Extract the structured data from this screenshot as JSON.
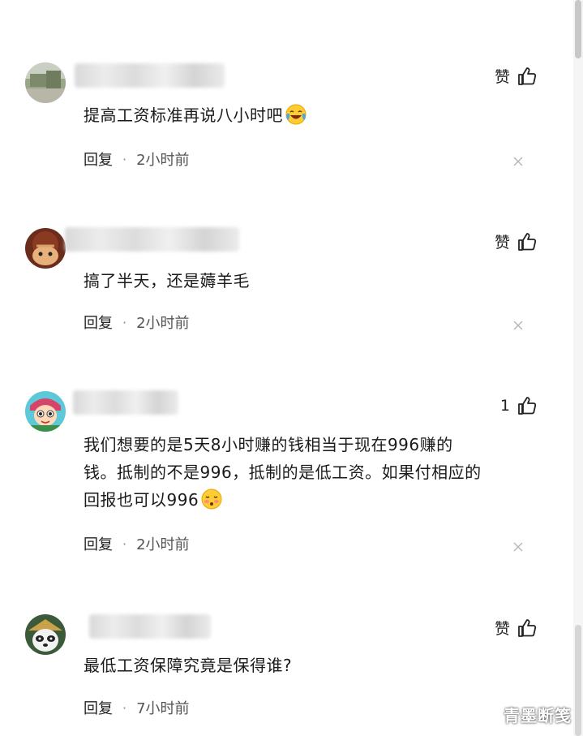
{
  "comments": [
    {
      "avatar_icon": "landscape-avatar-icon",
      "like_label": "赞",
      "text": "提高工资标准再说八小时吧",
      "emoji": "crying-laughing-emoji",
      "reply_label": "回复",
      "separator": "·",
      "time": "2小时前"
    },
    {
      "avatar_icon": "character-avatar-icon",
      "like_label": "赞",
      "text": "搞了半天，还是薅羊毛",
      "reply_label": "回复",
      "separator": "·",
      "time": "2小时前"
    },
    {
      "avatar_icon": "cartoon-girl-avatar-icon",
      "like_label": "1",
      "text_line1": "我们想要的是5天8小时赚的钱相当于现在996赚的",
      "text_line2": "钱。抵制的不是996，抵制的是低工资。如果付相应的",
      "text_line3": "回报也可以996",
      "emoji": "shy-face-emoji",
      "reply_label": "回复",
      "separator": "·",
      "time": "2小时前"
    },
    {
      "avatar_icon": "panda-avatar-icon",
      "like_label": "赞",
      "text": "最低工资保障究竟是保得谁?",
      "reply_label": "回复",
      "separator": "·",
      "time": "7小时前"
    }
  ],
  "watermark": "青墨断笺",
  "colors": {
    "text": "#1a1a1a",
    "meta": "#555555",
    "blur": "#dcdcdc"
  }
}
